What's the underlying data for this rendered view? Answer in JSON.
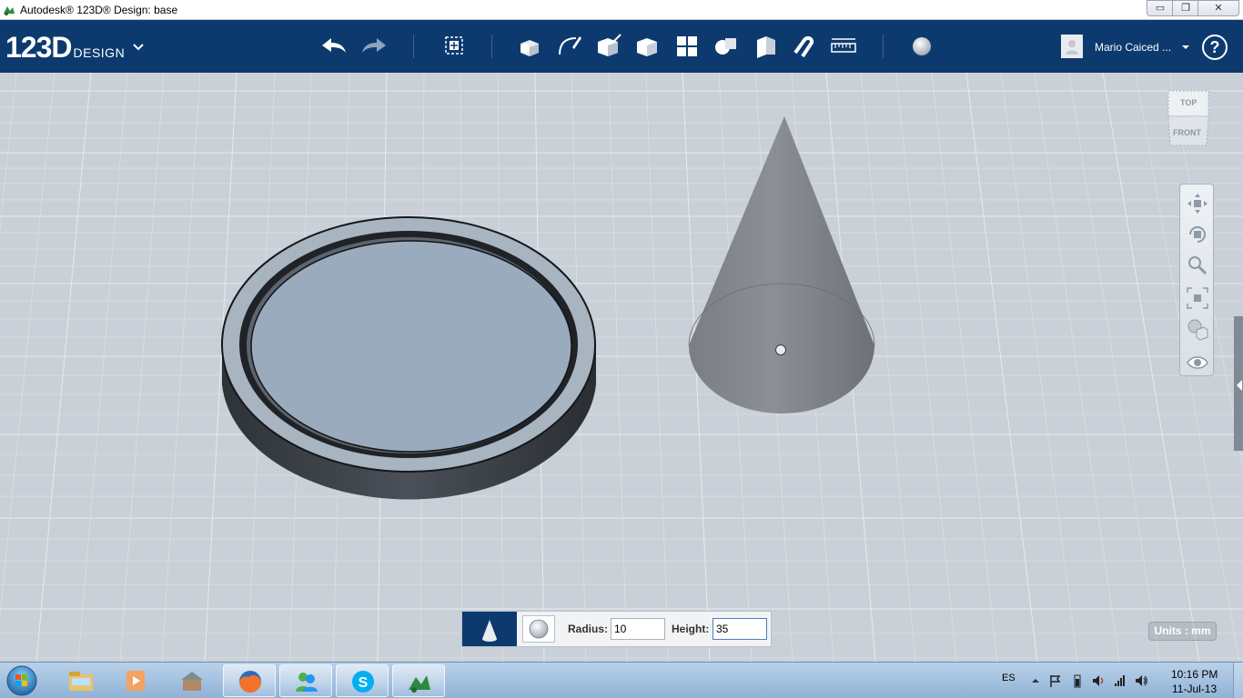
{
  "window": {
    "title": "Autodesk® 123D® Design: base",
    "min_label": "▭",
    "max_label": "❐",
    "close_label": "✕"
  },
  "toolbar": {
    "logo_number": "123D",
    "logo_word": "DESIGN",
    "icons": [
      "undo-icon",
      "redo-icon",
      "transform-icon",
      "primitives-icon",
      "sketch-icon",
      "construct-icon",
      "modify-icon",
      "pattern-icon",
      "group-icon",
      "combine-icon",
      "snap-icon",
      "measure-icon",
      "material-icon"
    ]
  },
  "user": {
    "name": "Mario Caiced ..."
  },
  "help": {
    "label": "?"
  },
  "viewcube": {
    "top_label": "TOP",
    "front_label": "FRONT"
  },
  "navbar": {
    "icons": [
      "pan-icon",
      "orbit-icon",
      "zoom-icon",
      "fit-icon",
      "view-style-icon",
      "visibility-icon"
    ]
  },
  "parambar": {
    "radius_label": "Radius:",
    "radius_value": "10",
    "height_label": "Height:",
    "height_value": "35"
  },
  "units": {
    "label": "Units : mm"
  },
  "taskbar": {
    "language": "ES",
    "time": "10:16 PM",
    "date": "11-Jul-13",
    "apps": [
      "file-explorer-icon",
      "media-player-icon",
      "generic-app-icon",
      "firefox-icon",
      "messenger-icon",
      "skype-icon",
      "123d-design-icon"
    ]
  },
  "colors": {
    "toolbar_bg": "#0c3a6e",
    "viewport_bg": "#c9d0d7",
    "grid_line": "#e6eaee",
    "cone_fill": "#7c7f86",
    "disc_fill": "#9aabbd"
  }
}
